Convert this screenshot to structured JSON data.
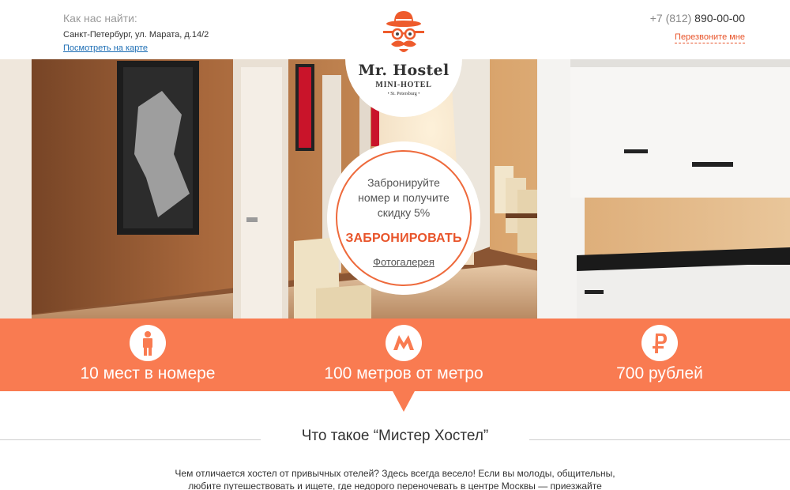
{
  "header": {
    "find_us_label": "Как нас найти:",
    "address": "Санкт-Петербург, ул. Марата, д.14/2",
    "map_link": "Посмотреть на карте",
    "phone_code": "+7 (812)",
    "phone_number": "890-00-00",
    "callback_link": "Перезвоните мне"
  },
  "logo": {
    "name": "Mr. Hostel",
    "subtitle": "MINI-HOTEL",
    "city": "• St. Petersburg •"
  },
  "booking": {
    "line1": "Забронируйте",
    "line2": "номер и получите",
    "line3": "скидку 5%",
    "book_button": "ЗАБРОНИРОВАТЬ",
    "gallery_link": "Фотогалерея"
  },
  "features": [
    {
      "icon": "person-icon",
      "label": "10 мест в номере"
    },
    {
      "icon": "metro-icon",
      "label": "100 метров от метро"
    },
    {
      "icon": "ruble-icon",
      "label": "700 рублей"
    }
  ],
  "about": {
    "title": "Что такое “Мистер Хостел”",
    "line1": "Чем отличается хостел от привычных отелей? Здесь всегда весело! Если вы молоды, общительны,",
    "line2": "любите путешествовать и ищете, где недорого переночевать в центре Москвы — приезжайте"
  },
  "colors": {
    "accent": "#f97b51",
    "link_orange": "#e8542a",
    "link_blue": "#1f6fb5"
  }
}
